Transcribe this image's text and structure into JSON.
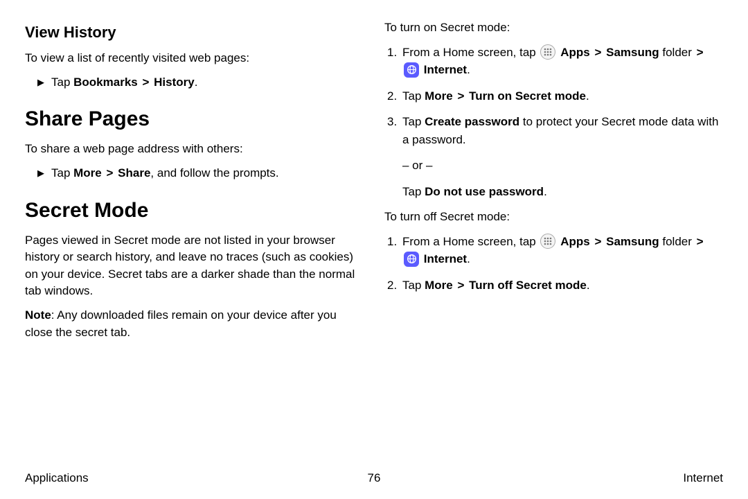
{
  "left": {
    "view_history": {
      "heading": "View History",
      "intro": "To view a list of recently visited web pages:",
      "bullet_prefix": "Tap ",
      "bullet_b1": "Bookmarks",
      "bullet_b2": "History",
      "bullet_suffix": "."
    },
    "share_pages": {
      "heading": "Share Pages",
      "intro": "To share a web page address with others:",
      "bullet_prefix": "Tap ",
      "bullet_b1": "More",
      "bullet_b2": "Share",
      "bullet_suffix": ", and follow the prompts."
    },
    "secret_mode": {
      "heading": "Secret Mode",
      "para1": "Pages viewed in Secret mode are not listed in your browser history or search history, and leave no traces (such as cookies) on your device. Secret tabs are a darker shade than the normal tab windows.",
      "note_label": "Note",
      "note_body": ": Any downloaded files remain on your device after you close the secret tab."
    }
  },
  "right": {
    "on_intro": "To turn on Secret mode:",
    "step1_a": "From a Home screen, tap ",
    "step1_apps": "Apps",
    "step1_samsung": "Samsung",
    "step1_folder": " folder ",
    "step1_internet": "Internet",
    "step1_end": ".",
    "step2_tap": "Tap ",
    "step2_more": "More",
    "step2_action_on": "Turn on Secret mode",
    "step2_end": ".",
    "step3_tap": "Tap ",
    "step3_create": "Create password",
    "step3_rest": " to protect your Secret mode data with a password.",
    "or_text": "– or –",
    "alt_tap": "Tap ",
    "alt_bold": "Do not use password",
    "alt_end": ".",
    "off_intro": "To turn off Secret mode:",
    "off2_action": "Turn off Secret mode"
  },
  "sep": ">",
  "footer": {
    "left": "Applications",
    "page": "76",
    "right": "Internet"
  }
}
